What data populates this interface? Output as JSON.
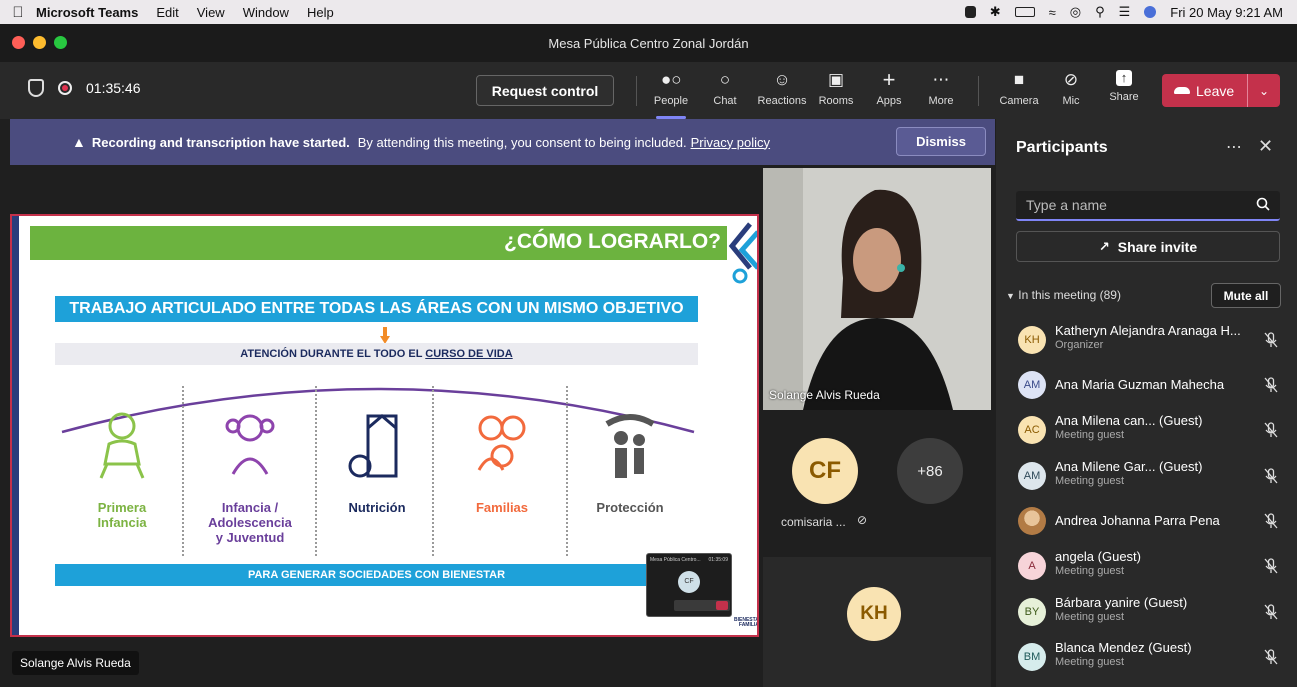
{
  "menubar": {
    "app_name": "Microsoft Teams",
    "items": [
      "Edit",
      "View",
      "Window",
      "Help"
    ],
    "datetime": "Fri 20 May  9:21 AM"
  },
  "window": {
    "title": "Mesa Pública Centro Zonal Jordán"
  },
  "toolbar": {
    "timer": "01:35:46",
    "request_control": "Request control",
    "tools": [
      {
        "label": "People",
        "icon": "people-icon",
        "active": true
      },
      {
        "label": "Chat",
        "icon": "chat-icon"
      },
      {
        "label": "Reactions",
        "icon": "reactions-icon"
      },
      {
        "label": "Rooms",
        "icon": "rooms-icon"
      },
      {
        "label": "Apps",
        "icon": "apps-icon"
      },
      {
        "label": "More",
        "icon": "more-icon"
      }
    ],
    "devices": [
      {
        "label": "Camera",
        "icon": "camera-off-icon"
      },
      {
        "label": "Mic",
        "icon": "mic-off-icon"
      },
      {
        "label": "Share",
        "icon": "share-icon"
      }
    ],
    "leave": "Leave"
  },
  "banner": {
    "bold": "Recording and transcription have started.",
    "text": "By attending this meeting, you consent to being included.",
    "link": "Privacy policy",
    "dismiss": "Dismiss"
  },
  "slide": {
    "title": "¿CÓMO LOGRARLO?",
    "objective": "TRABAJO ARTICULADO ENTRE TODAS LAS ÁREAS CON UN MISMO OBJETIVO",
    "attention_prefix": "ATENCIÓN DURANTE EL TODO EL",
    "attention_link": "CURSO DE VIDA",
    "areas": [
      {
        "label": "Primera\nInfancia",
        "color": "#7cb342"
      },
      {
        "label": "Infancia /\nAdolescencia\ny Juventud",
        "color": "#6a3f9b"
      },
      {
        "label": "Nutrición",
        "color": "#1b2a5e"
      },
      {
        "label": "Familias",
        "color": "#f26a3d"
      },
      {
        "label": "Protección",
        "color": "#555555"
      }
    ],
    "footer": "PARA GENERAR SOCIEDADES CON BIENESTAR",
    "mini_window_title": "Mesa Pública Centro...",
    "mini_window_time": "01:35:09",
    "mini_avatar": "CF",
    "brand": "BIENESTAR\nFAMILIAR"
  },
  "stage": {
    "presenter_name": "Solange Alvis Rueda",
    "video_name": "Solange Alvis Rueda",
    "tile_cf": {
      "initials": "CF",
      "name": "comisaria ..."
    },
    "overflow": "+86",
    "tile_kh": {
      "initials": "KH"
    }
  },
  "panel": {
    "title": "Participants",
    "search_placeholder": "Type a name",
    "share_invite": "Share invite",
    "in_meeting": "In this meeting (89)",
    "mute_all": "Mute all",
    "participants": [
      {
        "initials": "KH",
        "name": "Katheryn Alejandra Aranaga H...",
        "sub": "Organizer",
        "bg": "#f9e3b2",
        "fg": "#8b5a00"
      },
      {
        "initials": "AM",
        "name": "Ana Maria Guzman Mahecha",
        "sub": "",
        "bg": "#dde3f5",
        "fg": "#3a4a8a"
      },
      {
        "initials": "AC",
        "name": "Ana Milena can...  (Guest)",
        "sub": "Meeting guest",
        "bg": "#f9e3b2",
        "fg": "#8b5a00"
      },
      {
        "initials": "AM",
        "name": "Ana Milene Gar...  (Guest)",
        "sub": "Meeting guest",
        "bg": "#dde6ec",
        "fg": "#2f4a5a"
      },
      {
        "initials": "",
        "name": "Andrea Johanna Parra Pena",
        "sub": "",
        "bg": "#d9b48a",
        "fg": "#5a3a1a",
        "photo": true
      },
      {
        "initials": "A",
        "name": "angela (Guest)",
        "sub": "Meeting guest",
        "bg": "#f7d4d9",
        "fg": "#8a2a3a"
      },
      {
        "initials": "BY",
        "name": "Bárbara yanire (Guest)",
        "sub": "Meeting guest",
        "bg": "#e6f0d8",
        "fg": "#3e5a1a"
      },
      {
        "initials": "BM",
        "name": "Blanca Mendez (Guest)",
        "sub": "Meeting guest",
        "bg": "#d6ecec",
        "fg": "#1f5a5a"
      }
    ]
  }
}
